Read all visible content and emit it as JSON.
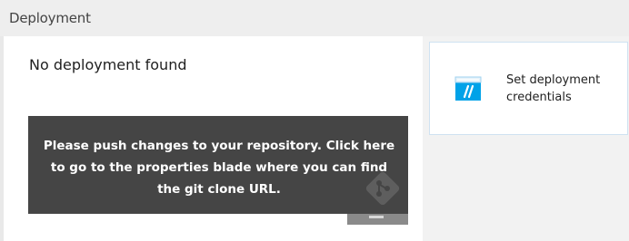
{
  "deployment_section": {
    "title": "Deployment"
  },
  "deployment_tile": {
    "status_text": "No deployment found",
    "tooltip_text": "Please push changes to your repository. Click here to go to the properties blade where you can find the git clone URL."
  },
  "credentials_tile": {
    "label": "Set deployment credentials",
    "icon": "deployment-credentials-icon"
  },
  "colors": {
    "tooltip_bg": "#454545",
    "accent": "#00a2e8"
  }
}
